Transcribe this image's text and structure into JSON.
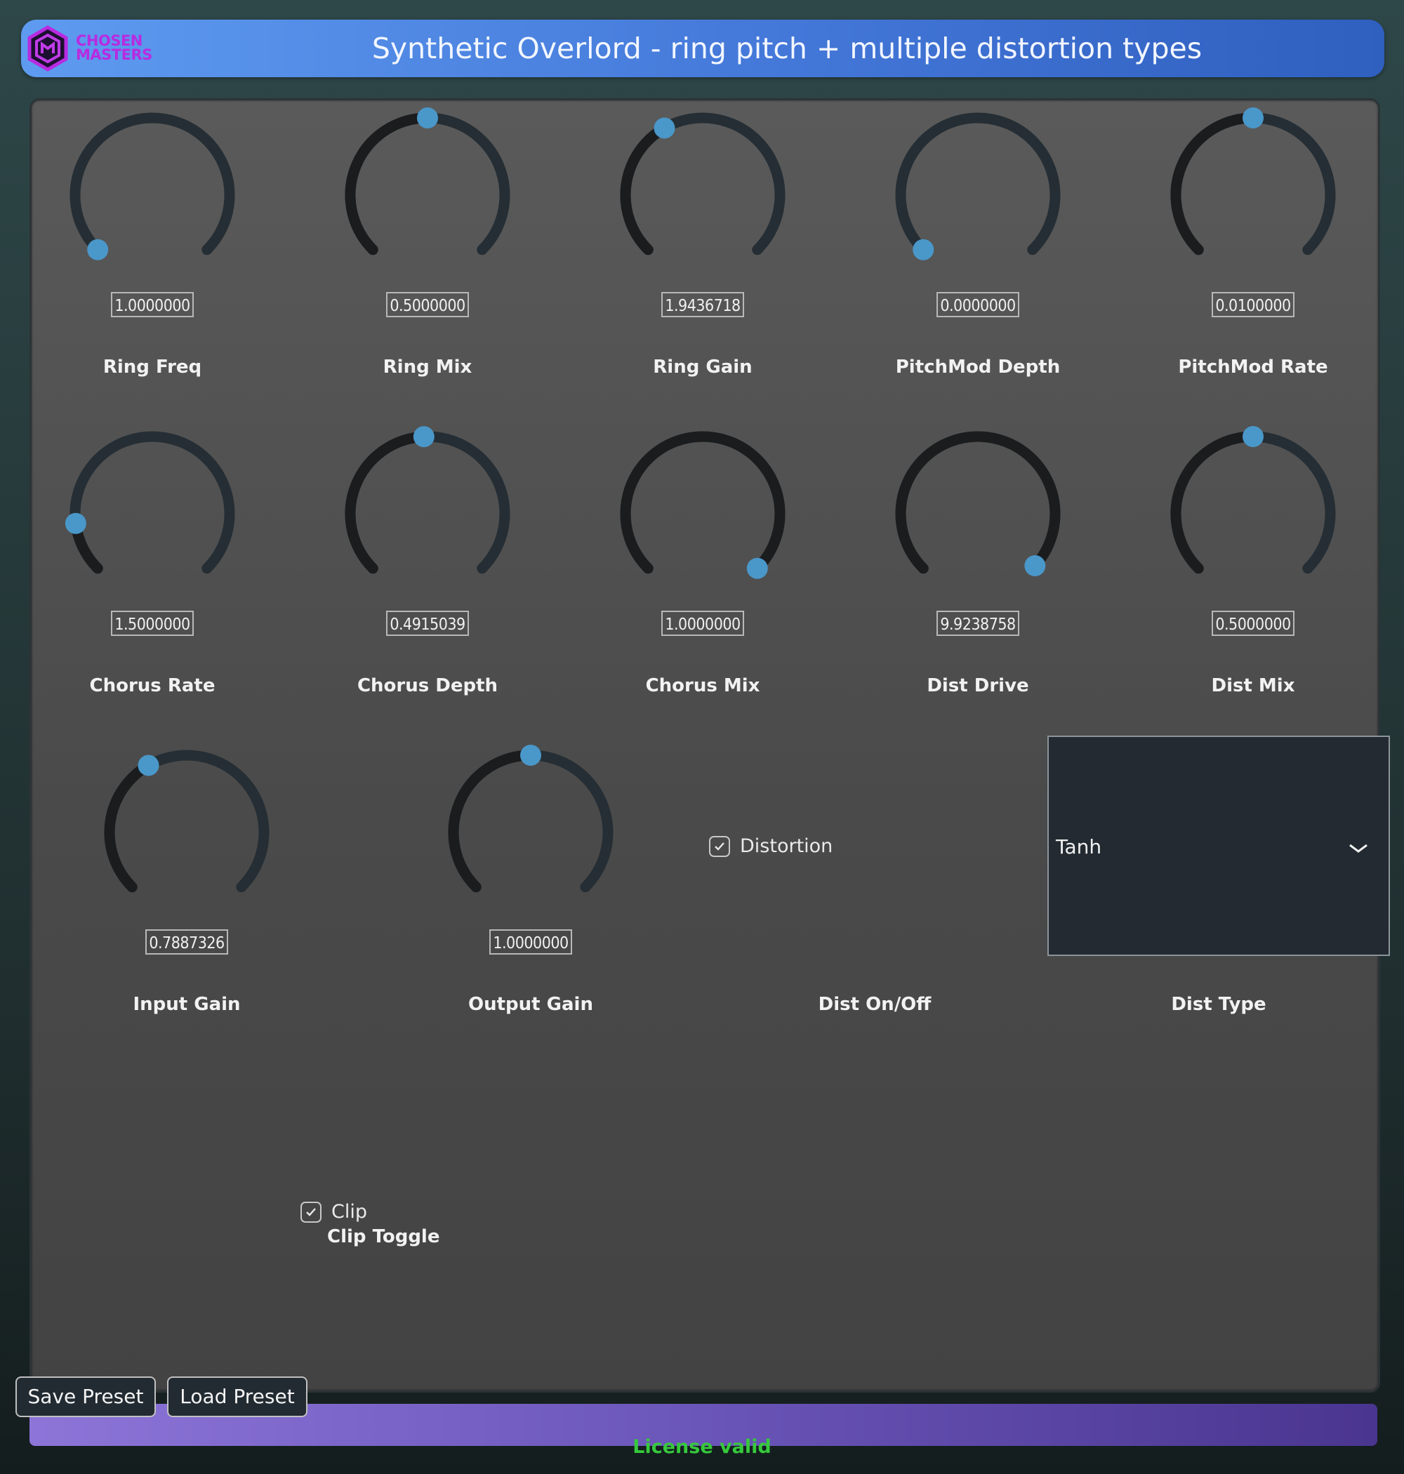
{
  "header": {
    "logo_line1": "CHOSEN",
    "logo_line2": "MASTERS",
    "title": "Synthetic Overlord - ring pitch + multiple distortion types"
  },
  "knobs": [
    {
      "label": "Ring Freq",
      "value": "1.0000000",
      "position": 0.0
    },
    {
      "label": "Ring Mix",
      "value": "0.5000000",
      "position": 0.5
    },
    {
      "label": "Ring Gain",
      "value": "1.9436718",
      "position": 0.39
    },
    {
      "label": "PitchMod Depth",
      "value": "0.0000000",
      "position": 0.0
    },
    {
      "label": "PitchMod Rate",
      "value": "0.0100000",
      "position": 0.5
    },
    {
      "label": "Chorus Rate",
      "value": "1.5000000",
      "position": 0.14
    },
    {
      "label": "Chorus Depth",
      "value": "0.4915039",
      "position": 0.49
    },
    {
      "label": "Chorus Mix",
      "value": "1.0000000",
      "position": 1.0
    },
    {
      "label": "Dist Drive",
      "value": "9.9238758",
      "position": 0.99
    },
    {
      "label": "Dist Mix",
      "value": "0.5000000",
      "position": 0.5
    },
    {
      "label": "Input Gain",
      "value": "0.7887326",
      "position": 0.39
    },
    {
      "label": "Output Gain",
      "value": "1.0000000",
      "position": 0.5
    }
  ],
  "distortion": {
    "checkbox_label": "Distortion",
    "checked": true,
    "section_label": "Dist On/Off"
  },
  "dist_type": {
    "selected": "Tanh",
    "section_label": "Dist Type"
  },
  "clip": {
    "checkbox_label": "Clip",
    "checked": true,
    "section_label": "Clip Toggle"
  },
  "buttons": {
    "save": "Save Preset",
    "load": "Load Preset"
  },
  "status": {
    "license": "License valid"
  },
  "colors": {
    "accent": "#4a97c9",
    "track": "#252e34",
    "license": "#36c93c"
  }
}
